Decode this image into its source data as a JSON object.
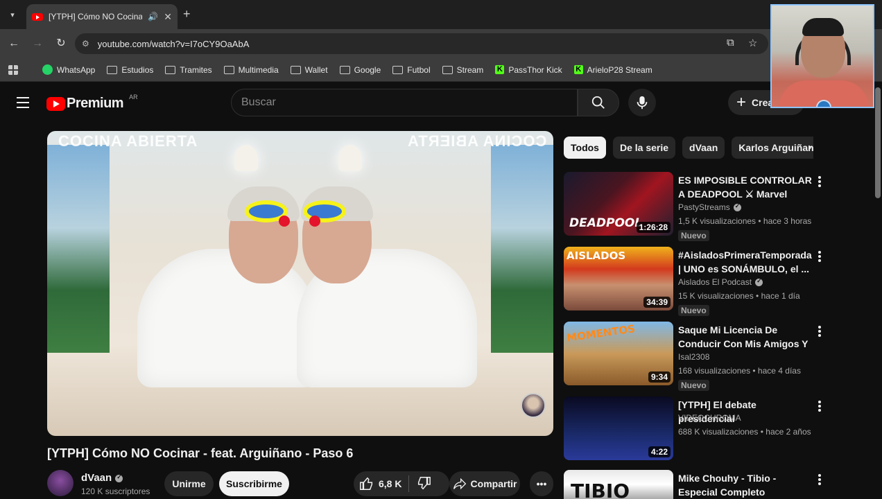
{
  "browser": {
    "tab_title": "[YTPH] Cómo NO Cocinar -",
    "url": "youtube.com/watch?v=I7oCY9OaAbA",
    "bookmarks": [
      "WhatsApp",
      "Estudios",
      "Tramites",
      "Multimedia",
      "Wallet",
      "Google",
      "Futbol",
      "Stream",
      "PassThor Kick",
      "ArieloP28 Stream"
    ]
  },
  "header": {
    "logo_text": "Premium",
    "region": "AR",
    "search_placeholder": "Buscar",
    "create_label": "Crear"
  },
  "video": {
    "title": "[YTPH] Cómo NO Cocinar - feat. Arguiñano - Paso 6",
    "overlay_brand": "COCINA ABIERTA",
    "channel": "dVaan",
    "subscribers": "120 K suscriptores",
    "join_label": "Unirme",
    "subscribe_label": "Suscribirme",
    "likes": "6,8 K",
    "share_label": "Compartir"
  },
  "chips": [
    "Todos",
    "De la serie",
    "dVaan",
    "Karlos Arguiñano"
  ],
  "recommendations": [
    {
      "title": "ES IMPOSIBLE CONTROLAR A DEADPOOL ⚔ Marvel Rivals | ...",
      "channel": "PastyStreams",
      "verified": true,
      "meta": "1,5 K visualizaciones • hace 3 horas",
      "badge": "Nuevo",
      "duration": "1:26:28",
      "thumb_text": "DEADPOOL"
    },
    {
      "title": "#AisladosPrimeraTemporada | UNO es SONÁMBULO, el ...",
      "channel": "Aislados El Podcast",
      "verified": true,
      "meta": "15 K visualizaciones • hace 1 día",
      "badge": "Nuevo",
      "duration": "34:39",
      "thumb_text": "AISLADOS"
    },
    {
      "title": "Saque Mi Licencia De Conducir Con Mis Amigos Y Así La Use!!!",
      "channel": "Isal2308",
      "verified": false,
      "meta": "168 visualizaciones • hace 4 días",
      "badge": "Nuevo",
      "duration": "9:34",
      "thumb_text": "MOMENTOS"
    },
    {
      "title": "[YTPH] El debate presidencial",
      "channel": "VIDEOCHROMA",
      "verified": false,
      "meta": "688 K visualizaciones • hace 2 años",
      "badge": "",
      "duration": "4:22",
      "thumb_text": ""
    },
    {
      "title": "Mike Chouhy - Tibio - Especial Completo",
      "channel": "",
      "verified": false,
      "meta": "",
      "badge": "",
      "duration": "",
      "thumb_text": "TIBIO"
    }
  ]
}
